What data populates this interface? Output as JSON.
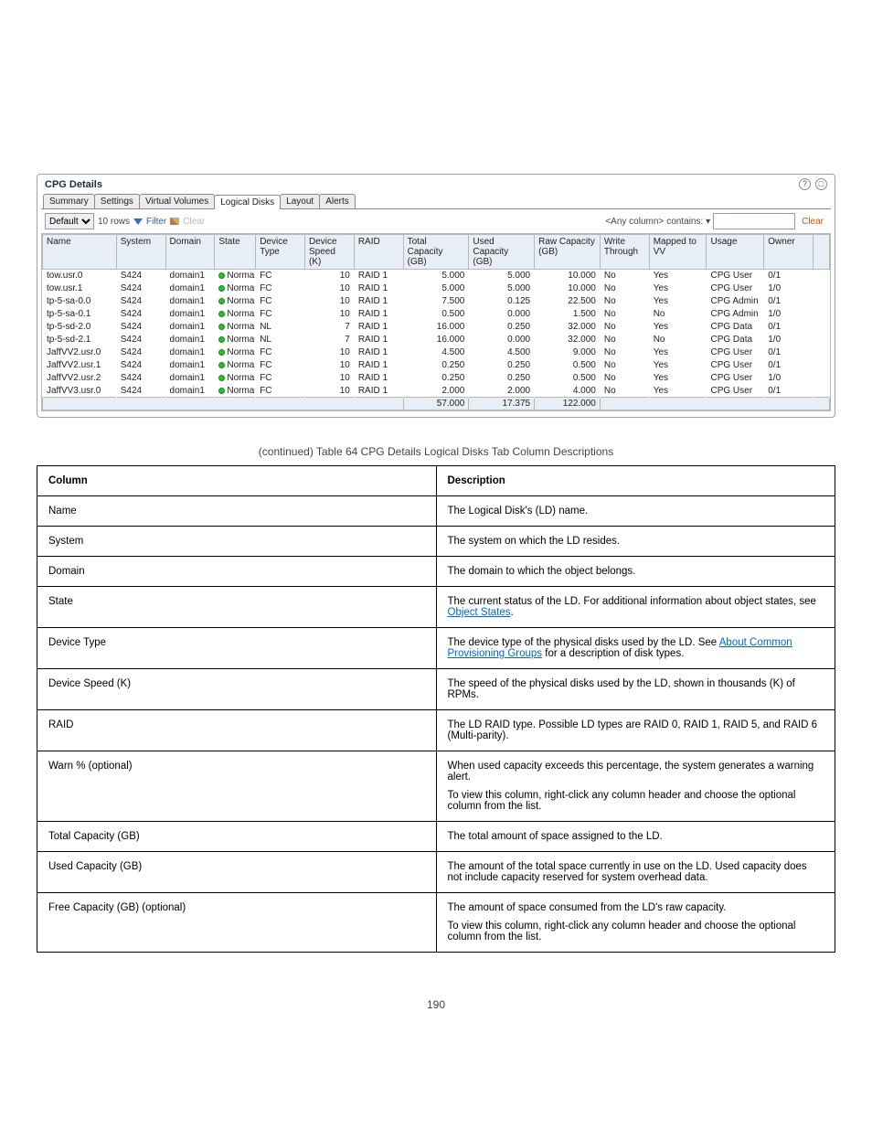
{
  "panel": {
    "title": "CPG Details",
    "tabs": [
      "Summary",
      "Settings",
      "Virtual Volumes",
      "Logical Disks",
      "Layout",
      "Alerts"
    ],
    "active_tab_index": 3,
    "toolbar": {
      "default_option": "Default",
      "row_count_label": "10 rows",
      "filter_label": "Filter",
      "clear_label": "Clear",
      "any_column_label": "<Any column>",
      "contains_label": " contains: ",
      "clear_link": "Clear"
    },
    "columns": [
      "Name",
      "System",
      "Domain",
      "State",
      "Device Type",
      "Device Speed (K)",
      "RAID",
      "Total Capacity (GB)",
      "Used Capacity (GB)",
      "Raw Capacity (GB)",
      "Write Through",
      "Mapped to VV",
      "Usage",
      "Owner"
    ],
    "rows": [
      {
        "name": "tow.usr.0",
        "system": "S424",
        "domain": "domain1",
        "state": "Normal",
        "dtype": "FC",
        "speed": "10",
        "raid": "RAID 1",
        "total": "5.000",
        "used": "5.000",
        "raw": "10.000",
        "wt": "No",
        "mapped": "Yes",
        "usage": "CPG User",
        "owner": "0/1"
      },
      {
        "name": "tow.usr.1",
        "system": "S424",
        "domain": "domain1",
        "state": "Normal",
        "dtype": "FC",
        "speed": "10",
        "raid": "RAID 1",
        "total": "5.000",
        "used": "5.000",
        "raw": "10.000",
        "wt": "No",
        "mapped": "Yes",
        "usage": "CPG User",
        "owner": "1/0"
      },
      {
        "name": "tp-5-sa-0.0",
        "system": "S424",
        "domain": "domain1",
        "state": "Normal",
        "dtype": "FC",
        "speed": "10",
        "raid": "RAID 1",
        "total": "7.500",
        "used": "0.125",
        "raw": "22.500",
        "wt": "No",
        "mapped": "Yes",
        "usage": "CPG Admin",
        "owner": "0/1"
      },
      {
        "name": "tp-5-sa-0.1",
        "system": "S424",
        "domain": "domain1",
        "state": "Normal",
        "dtype": "FC",
        "speed": "10",
        "raid": "RAID 1",
        "total": "0.500",
        "used": "0.000",
        "raw": "1.500",
        "wt": "No",
        "mapped": "No",
        "usage": "CPG Admin",
        "owner": "1/0"
      },
      {
        "name": "tp-5-sd-2.0",
        "system": "S424",
        "domain": "domain1",
        "state": "Normal",
        "dtype": "NL",
        "speed": "7",
        "raid": "RAID 1",
        "total": "16.000",
        "used": "0.250",
        "raw": "32.000",
        "wt": "No",
        "mapped": "Yes",
        "usage": "CPG Data",
        "owner": "0/1"
      },
      {
        "name": "tp-5-sd-2.1",
        "system": "S424",
        "domain": "domain1",
        "state": "Normal",
        "dtype": "NL",
        "speed": "7",
        "raid": "RAID 1",
        "total": "16.000",
        "used": "0.000",
        "raw": "32.000",
        "wt": "No",
        "mapped": "No",
        "usage": "CPG Data",
        "owner": "1/0"
      },
      {
        "name": "JaffVV2.usr.0",
        "system": "S424",
        "domain": "domain1",
        "state": "Normal",
        "dtype": "FC",
        "speed": "10",
        "raid": "RAID 1",
        "total": "4.500",
        "used": "4.500",
        "raw": "9.000",
        "wt": "No",
        "mapped": "Yes",
        "usage": "CPG User",
        "owner": "0/1"
      },
      {
        "name": "JaffVV2.usr.1",
        "system": "S424",
        "domain": "domain1",
        "state": "Normal",
        "dtype": "FC",
        "speed": "10",
        "raid": "RAID 1",
        "total": "0.250",
        "used": "0.250",
        "raw": "0.500",
        "wt": "No",
        "mapped": "Yes",
        "usage": "CPG User",
        "owner": "0/1"
      },
      {
        "name": "JaffVV2.usr.2",
        "system": "S424",
        "domain": "domain1",
        "state": "Normal",
        "dtype": "FC",
        "speed": "10",
        "raid": "RAID 1",
        "total": "0.250",
        "used": "0.250",
        "raw": "0.500",
        "wt": "No",
        "mapped": "Yes",
        "usage": "CPG User",
        "owner": "1/0"
      },
      {
        "name": "JaffVV3.usr.0",
        "system": "S424",
        "domain": "domain1",
        "state": "Normal",
        "dtype": "FC",
        "speed": "10",
        "raid": "RAID 1",
        "total": "2.000",
        "used": "2.000",
        "raw": "4.000",
        "wt": "No",
        "mapped": "Yes",
        "usage": "CPG User",
        "owner": "0/1"
      }
    ],
    "totals": {
      "total": "57.000",
      "used": "17.375",
      "raw": "122.000"
    }
  },
  "caption": "CPG Details Logical Disks Tab Column Descriptions",
  "desc": {
    "headers": [
      "Column",
      "Description"
    ],
    "rows": [
      {
        "c": "Name",
        "d": [
          "The Logical Disk's (LD) name."
        ]
      },
      {
        "c": "System",
        "d": [
          "The system on which the LD resides."
        ]
      },
      {
        "c": "Domain",
        "d": [
          "The domain to which the object belongs."
        ]
      },
      {
        "c": "State",
        "d": [
          "The current status of the LD. For additional information about object states, see ",
          {
            "link": "Object States"
          },
          "."
        ]
      },
      {
        "c": "Device Type",
        "d": [
          "The device type of the physical disks used by the LD. See ",
          {
            "link": "About Common Provisioning Groups"
          },
          " for a description of disk types."
        ]
      },
      {
        "c": "Device Speed (K)",
        "d": [
          "The speed of the physical disks used by the LD, shown in thousands (K) of RPMs."
        ]
      },
      {
        "c": "RAID",
        "d": [
          "The LD RAID type. Possible LD types are RAID 0, RAID 1, RAID 5, and RAID 6 (Multi-parity)."
        ]
      },
      {
        "c": "Warn % (optional)",
        "d": [
          "When used capacity exceeds this percentage, the system generates a warning alert.",
          "To view this column, right-click any column header and choose the optional column from the list."
        ]
      },
      {
        "c": "Total Capacity (GB)",
        "d": [
          "The total amount of space assigned to the LD."
        ]
      },
      {
        "c": "Used Capacity (GB)",
        "d": [
          "The amount of the total space currently in use on the LD. Used capacity does not include capacity reserved for system overhead data."
        ]
      },
      {
        "c": "Free Capacity (GB) (optional)",
        "d": [
          "The amount of space consumed from the LD's raw capacity.",
          "To view this column, right-click any column header and choose the optional column from the list."
        ]
      }
    ]
  },
  "page_number": "190"
}
